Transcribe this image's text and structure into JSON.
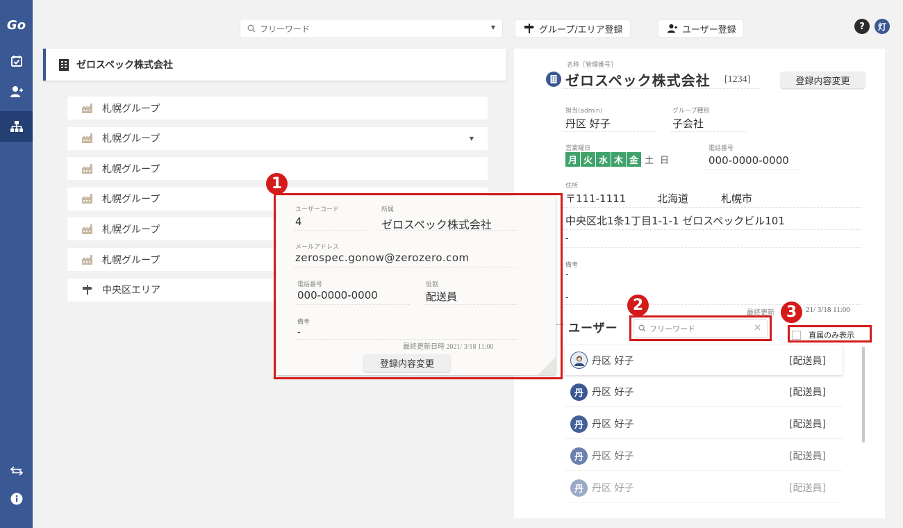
{
  "app": {
    "logo": "Go"
  },
  "top": {
    "search_placeholder": "フリーワード",
    "group_area_button": "グループ/エリア登録",
    "user_button": "ユーザー登録",
    "help": "?",
    "user_badge": "灯"
  },
  "left": {
    "company": "ゼロスペック株式会社",
    "groups": [
      {
        "label": "札幌グループ",
        "icon": "factory-icon"
      },
      {
        "label": "札幌グループ",
        "icon": "factory-icon",
        "has_dropdown": true
      },
      {
        "label": "札幌グループ",
        "icon": "factory-icon"
      },
      {
        "label": "札幌グループ",
        "icon": "factory-icon"
      },
      {
        "label": "札幌グループ",
        "icon": "factory-icon"
      },
      {
        "label": "札幌グループ",
        "icon": "factory-icon"
      },
      {
        "label": "中央区エリア",
        "icon": "signpost-icon"
      }
    ]
  },
  "detail": {
    "name_label": "名称［管理番号］",
    "name": "ゼロスペック株式会社",
    "code": "[1234]",
    "edit_button": "登録内容変更",
    "manager_label": "担当(admin)",
    "manager": "丹区 好子",
    "group_type_label": "グループ種別",
    "group_type": "子会社",
    "business_days_label": "営業曜日",
    "days": [
      {
        "d": "月",
        "on": true
      },
      {
        "d": "火",
        "on": true
      },
      {
        "d": "水",
        "on": true
      },
      {
        "d": "木",
        "on": true
      },
      {
        "d": "金",
        "on": true
      },
      {
        "d": "土",
        "on": false
      },
      {
        "d": "日",
        "on": false
      }
    ],
    "phone_label": "電話番号",
    "phone": "000-0000-0000",
    "address_label": "住所",
    "postal": "〒111-1111",
    "prefecture": "北海道",
    "city": "札幌市",
    "address_line": "中央区北1条1丁目1-1-1 ゼロスペックビル101",
    "address_line2": "-",
    "note_label": "備考",
    "note1": "-",
    "note2": "-",
    "updated": "最終更新",
    "updated_time": "21/ 3/18 11:00",
    "users_heading": "ユーザー",
    "user_search_placeholder": "フリーワード",
    "direct_only": "直属のみ表示",
    "users": [
      {
        "name": "丹区 好子",
        "role": "[配送員]",
        "avatar": "photo"
      },
      {
        "name": "丹区 好子",
        "role": "[配送員]",
        "avatar": "丹"
      },
      {
        "name": "丹区 好子",
        "role": "[配送員]",
        "avatar": "丹"
      },
      {
        "name": "丹区 好子",
        "role": "[配送員]",
        "avatar": "丹"
      },
      {
        "name": "丹区 好子",
        "role": "[配送員]",
        "avatar": "丹"
      }
    ]
  },
  "popup": {
    "user_code_label": "ユーザーコード",
    "user_code": "4",
    "affiliation_label": "所属",
    "affiliation": "ゼロスペック株式会社",
    "email_label": "メールアドレス",
    "email": "zerospec.gonow@zerozero.com",
    "phone_label": "電話番号",
    "phone": "000-0000-0000",
    "role_label": "役割",
    "role": "配送員",
    "note_label": "備考",
    "note": "-",
    "updated": "最終更新日時 2021/ 3/18 11:00",
    "edit_button": "登録内容変更"
  },
  "annotations": [
    "1",
    "2",
    "3"
  ],
  "colors": {
    "accent": "#3a5893",
    "highlight": "#d51a1a",
    "day_on": "#3fa26a"
  }
}
